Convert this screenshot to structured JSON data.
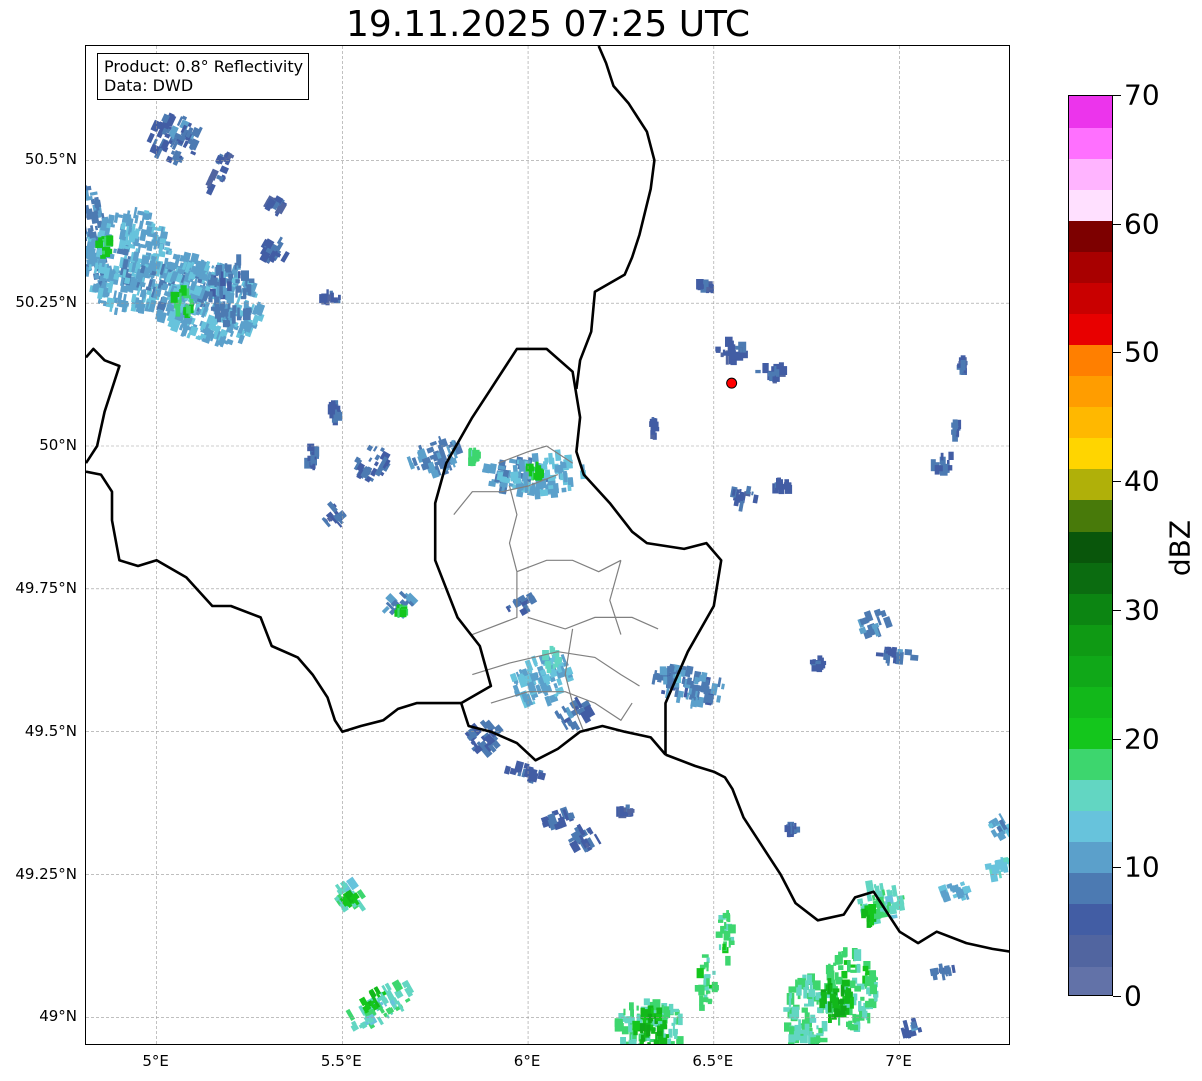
{
  "title": "19.11.2025 07:25 UTC",
  "info_box": {
    "product_line": "Product: 0.8° Reflectivity",
    "data_line": "Data: DWD"
  },
  "map": {
    "lon_range": [
      4.81,
      7.3
    ],
    "lat_range": [
      48.95,
      50.7
    ],
    "lon_ticks": [
      {
        "value": 5.0,
        "label": "5°E"
      },
      {
        "value": 5.5,
        "label": "5.5°E"
      },
      {
        "value": 6.0,
        "label": "6°E"
      },
      {
        "value": 6.5,
        "label": "6.5°E"
      },
      {
        "value": 7.0,
        "label": "7°E"
      }
    ],
    "lat_ticks": [
      {
        "value": 50.5,
        "label": "50.5°N"
      },
      {
        "value": 50.25,
        "label": "50.25°N"
      },
      {
        "value": 50.0,
        "label": "50°N"
      },
      {
        "value": 49.75,
        "label": "49.75°N"
      },
      {
        "value": 49.5,
        "label": "49.5°N"
      },
      {
        "value": 49.25,
        "label": "49.25°N"
      },
      {
        "value": 49.0,
        "label": "49°N"
      }
    ],
    "grid": true,
    "radar_site": {
      "lon": 6.548,
      "lat": 50.11,
      "color": "#ff0000"
    },
    "borders": [
      [
        [
          4.81,
          50.155
        ],
        [
          4.83,
          50.17
        ],
        [
          4.86,
          50.15
        ],
        [
          4.9,
          50.14
        ],
        [
          4.88,
          50.1
        ],
        [
          4.86,
          50.06
        ],
        [
          4.84,
          50.0
        ],
        [
          4.82,
          49.98
        ],
        [
          4.81,
          49.97
        ]
      ],
      [
        [
          4.81,
          49.955
        ],
        [
          4.85,
          49.95
        ],
        [
          4.88,
          49.92
        ],
        [
          4.88,
          49.87
        ],
        [
          4.9,
          49.8
        ],
        [
          4.95,
          49.79
        ],
        [
          5.0,
          49.8
        ],
        [
          5.08,
          49.77
        ],
        [
          5.15,
          49.72
        ],
        [
          5.2,
          49.72
        ],
        [
          5.28,
          49.7
        ],
        [
          5.31,
          49.65
        ],
        [
          5.38,
          49.63
        ],
        [
          5.42,
          49.6
        ],
        [
          5.46,
          49.56
        ],
        [
          5.48,
          49.52
        ],
        [
          5.5,
          49.5
        ],
        [
          5.55,
          49.51
        ],
        [
          5.61,
          49.52
        ],
        [
          5.65,
          49.54
        ],
        [
          5.7,
          49.55
        ],
        [
          5.76,
          49.55
        ],
        [
          5.82,
          49.55
        ]
      ],
      [
        [
          5.82,
          49.55
        ],
        [
          5.84,
          49.51
        ],
        [
          5.9,
          49.5
        ],
        [
          5.97,
          49.48
        ],
        [
          6.02,
          49.45
        ],
        [
          6.08,
          49.47
        ],
        [
          6.14,
          49.5
        ],
        [
          6.2,
          49.51
        ],
        [
          6.26,
          49.5
        ],
        [
          6.33,
          49.49
        ],
        [
          6.37,
          49.46
        ]
      ],
      [
        [
          6.37,
          49.46
        ],
        [
          6.45,
          49.44
        ],
        [
          6.5,
          49.43
        ],
        [
          6.53,
          49.42
        ],
        [
          6.55,
          49.4
        ],
        [
          6.58,
          49.35
        ],
        [
          6.62,
          49.31
        ],
        [
          6.65,
          49.28
        ],
        [
          6.68,
          49.25
        ],
        [
          6.72,
          49.2
        ],
        [
          6.78,
          49.17
        ],
        [
          6.85,
          49.18
        ],
        [
          6.88,
          49.21
        ],
        [
          6.93,
          49.22
        ],
        [
          6.97,
          49.18
        ],
        [
          7.0,
          49.15
        ],
        [
          7.05,
          49.13
        ],
        [
          7.1,
          49.15
        ],
        [
          7.18,
          49.13
        ],
        [
          7.25,
          49.12
        ],
        [
          7.3,
          49.115
        ]
      ],
      [
        [
          6.37,
          49.46
        ],
        [
          6.37,
          49.55
        ],
        [
          6.43,
          49.64
        ],
        [
          6.5,
          49.72
        ],
        [
          6.52,
          49.8
        ],
        [
          6.48,
          49.83
        ],
        [
          6.42,
          49.82
        ],
        [
          6.32,
          49.83
        ],
        [
          6.28,
          49.85
        ],
        [
          6.22,
          49.9
        ],
        [
          6.15,
          49.95
        ],
        [
          6.13,
          49.99
        ],
        [
          6.14,
          50.05
        ],
        [
          6.12,
          50.13
        ],
        [
          6.05,
          50.17
        ],
        [
          5.97,
          50.17
        ],
        [
          5.9,
          50.1
        ],
        [
          5.85,
          50.05
        ],
        [
          5.78,
          49.97
        ],
        [
          5.75,
          49.9
        ],
        [
          5.75,
          49.8
        ],
        [
          5.81,
          49.7
        ],
        [
          5.87,
          49.65
        ],
        [
          5.9,
          49.58
        ],
        [
          5.82,
          49.55
        ]
      ],
      [
        [
          6.13,
          50.1
        ],
        [
          6.14,
          50.15
        ],
        [
          6.17,
          50.2
        ],
        [
          6.18,
          50.27
        ],
        [
          6.26,
          50.3
        ],
        [
          6.28,
          50.33
        ],
        [
          6.3,
          50.37
        ],
        [
          6.33,
          50.45
        ],
        [
          6.34,
          50.5
        ],
        [
          6.32,
          50.55
        ],
        [
          6.27,
          50.6
        ],
        [
          6.23,
          50.63
        ],
        [
          6.21,
          50.67
        ],
        [
          6.19,
          50.7
        ]
      ]
    ],
    "admin_lines": [
      [
        [
          6.08,
          49.95
        ],
        [
          6.0,
          49.93
        ],
        [
          5.93,
          49.92
        ],
        [
          5.85,
          49.92
        ],
        [
          5.8,
          49.88
        ]
      ],
      [
        [
          5.95,
          49.93
        ],
        [
          5.97,
          49.88
        ],
        [
          5.95,
          49.83
        ],
        [
          5.97,
          49.78
        ]
      ],
      [
        [
          5.97,
          49.78
        ],
        [
          6.05,
          49.8
        ],
        [
          6.12,
          49.8
        ],
        [
          6.19,
          49.78
        ],
        [
          6.25,
          49.8
        ]
      ],
      [
        [
          6.25,
          49.8
        ],
        [
          6.22,
          49.73
        ],
        [
          6.25,
          49.67
        ]
      ],
      [
        [
          5.97,
          49.78
        ],
        [
          5.97,
          49.7
        ],
        [
          5.85,
          49.67
        ]
      ],
      [
        [
          6.0,
          49.7
        ],
        [
          6.1,
          49.68
        ],
        [
          6.18,
          49.7
        ],
        [
          6.28,
          49.7
        ],
        [
          6.35,
          49.68
        ]
      ],
      [
        [
          5.85,
          49.6
        ],
        [
          5.95,
          49.62
        ],
        [
          6.08,
          49.64
        ],
        [
          6.18,
          49.63
        ],
        [
          6.25,
          49.6
        ],
        [
          6.3,
          49.58
        ]
      ],
      [
        [
          5.9,
          49.55
        ],
        [
          6.0,
          49.57
        ],
        [
          6.1,
          49.57
        ],
        [
          6.18,
          49.55
        ],
        [
          6.25,
          49.52
        ],
        [
          6.28,
          49.55
        ]
      ],
      [
        [
          6.12,
          49.68
        ],
        [
          6.1,
          49.6
        ],
        [
          6.12,
          49.55
        ],
        [
          6.15,
          49.5
        ]
      ],
      [
        [
          5.92,
          49.97
        ],
        [
          6.0,
          49.99
        ],
        [
          6.05,
          50.0
        ],
        [
          6.12,
          49.97
        ]
      ]
    ]
  },
  "colorbar": {
    "label": "dBZ",
    "min": 0,
    "max": 70,
    "ticks": [
      {
        "value": 0,
        "label": "0"
      },
      {
        "value": 10,
        "label": "10"
      },
      {
        "value": 20,
        "label": "20"
      },
      {
        "value": 30,
        "label": "30"
      },
      {
        "value": 40,
        "label": "40"
      },
      {
        "value": 50,
        "label": "50"
      },
      {
        "value": 60,
        "label": "60"
      },
      {
        "value": 70,
        "label": "70"
      }
    ],
    "colors": [
      "#6272a8",
      "#5165a0",
      "#425da4",
      "#4c7ab2",
      "#5ba0cb",
      "#67c3dc",
      "#62d6c2",
      "#3dd66e",
      "#14c61c",
      "#12b81a",
      "#10a818",
      "#0f9a14",
      "#0c8512",
      "#0b6c10",
      "#09560b",
      "#487a0a",
      "#b0b009",
      "#ffd500",
      "#ffb800",
      "#ff9d00",
      "#ff7f00",
      "#e80000",
      "#c90000",
      "#a80000",
      "#7d0000",
      "#ffe0ff",
      "#ffb4ff",
      "#ff70ff",
      "#ec34ec"
    ]
  },
  "echo_clusters": [
    {
      "lon": 4.83,
      "lat": 50.37,
      "rx": 0.04,
      "ry": 0.1,
      "angle": -10,
      "level": 10
    },
    {
      "lon": 4.93,
      "lat": 50.32,
      "rx": 0.12,
      "ry": 0.09,
      "angle": 10,
      "level": 12
    },
    {
      "lon": 5.05,
      "lat": 50.28,
      "rx": 0.1,
      "ry": 0.06,
      "angle": 15,
      "level": 11
    },
    {
      "lon": 5.15,
      "lat": 50.25,
      "rx": 0.14,
      "ry": 0.07,
      "angle": 20,
      "level": 12
    },
    {
      "lon": 5.07,
      "lat": 50.25,
      "rx": 0.03,
      "ry": 0.03,
      "angle": 0,
      "level": 20
    },
    {
      "lon": 4.86,
      "lat": 50.35,
      "rx": 0.02,
      "ry": 0.02,
      "angle": 0,
      "level": 20
    },
    {
      "lon": 5.05,
      "lat": 50.54,
      "rx": 0.07,
      "ry": 0.04,
      "angle": 25,
      "level": 8
    },
    {
      "lon": 5.17,
      "lat": 50.48,
      "rx": 0.02,
      "ry": 0.04,
      "angle": 25,
      "level": 6
    },
    {
      "lon": 5.32,
      "lat": 50.42,
      "rx": 0.025,
      "ry": 0.012,
      "angle": 30,
      "level": 6
    },
    {
      "lon": 5.32,
      "lat": 50.34,
      "rx": 0.035,
      "ry": 0.025,
      "angle": 30,
      "level": 7
    },
    {
      "lon": 5.2,
      "lat": 50.27,
      "rx": 0.06,
      "ry": 0.06,
      "angle": 0,
      "level": 9
    },
    {
      "lon": 5.47,
      "lat": 50.26,
      "rx": 0.025,
      "ry": 0.01,
      "angle": 0,
      "level": 6
    },
    {
      "lon": 5.42,
      "lat": 49.98,
      "rx": 0.015,
      "ry": 0.02,
      "angle": 0,
      "level": 7
    },
    {
      "lon": 5.58,
      "lat": 49.97,
      "rx": 0.04,
      "ry": 0.03,
      "angle": 30,
      "level": 8
    },
    {
      "lon": 5.75,
      "lat": 49.98,
      "rx": 0.07,
      "ry": 0.03,
      "angle": -20,
      "level": 10
    },
    {
      "lon": 5.96,
      "lat": 49.95,
      "rx": 0.09,
      "ry": 0.03,
      "angle": 10,
      "level": 11
    },
    {
      "lon": 6.05,
      "lat": 49.95,
      "rx": 0.1,
      "ry": 0.035,
      "angle": -5,
      "level": 12
    },
    {
      "lon": 6.02,
      "lat": 49.96,
      "rx": 0.02,
      "ry": 0.015,
      "angle": 0,
      "level": 20
    },
    {
      "lon": 5.85,
      "lat": 49.98,
      "rx": 0.015,
      "ry": 0.012,
      "angle": 0,
      "level": 18
    },
    {
      "lon": 5.48,
      "lat": 49.88,
      "rx": 0.035,
      "ry": 0.02,
      "angle": -40,
      "level": 7
    },
    {
      "lon": 5.48,
      "lat": 50.06,
      "rx": 0.012,
      "ry": 0.015,
      "angle": 0,
      "level": 7
    },
    {
      "lon": 5.65,
      "lat": 49.72,
      "rx": 0.045,
      "ry": 0.02,
      "angle": -45,
      "level": 10
    },
    {
      "lon": 5.66,
      "lat": 49.71,
      "rx": 0.012,
      "ry": 0.008,
      "angle": 0,
      "level": 20
    },
    {
      "lon": 5.98,
      "lat": 49.72,
      "rx": 0.04,
      "ry": 0.015,
      "angle": -30,
      "level": 8
    },
    {
      "lon": 6.04,
      "lat": 49.59,
      "rx": 0.09,
      "ry": 0.04,
      "angle": -20,
      "level": 12
    },
    {
      "lon": 6.06,
      "lat": 49.62,
      "rx": 0.025,
      "ry": 0.025,
      "angle": 0,
      "level": 16
    },
    {
      "lon": 6.12,
      "lat": 49.53,
      "rx": 0.05,
      "ry": 0.02,
      "angle": -30,
      "level": 8
    },
    {
      "lon": 5.88,
      "lat": 49.49,
      "rx": 0.05,
      "ry": 0.025,
      "angle": -40,
      "level": 8
    },
    {
      "lon": 5.99,
      "lat": 49.43,
      "rx": 0.05,
      "ry": 0.015,
      "angle": 15,
      "level": 7
    },
    {
      "lon": 6.08,
      "lat": 49.35,
      "rx": 0.04,
      "ry": 0.015,
      "angle": -20,
      "level": 7
    },
    {
      "lon": 6.15,
      "lat": 49.31,
      "rx": 0.04,
      "ry": 0.02,
      "angle": -30,
      "level": 7
    },
    {
      "lon": 6.26,
      "lat": 49.36,
      "rx": 0.02,
      "ry": 0.006,
      "angle": 0,
      "level": 6
    },
    {
      "lon": 6.43,
      "lat": 49.58,
      "rx": 0.1,
      "ry": 0.03,
      "angle": 10,
      "level": 9
    },
    {
      "lon": 6.39,
      "lat": 49.6,
      "rx": 0.03,
      "ry": 0.02,
      "angle": 0,
      "level": 11
    },
    {
      "lon": 6.58,
      "lat": 49.91,
      "rx": 0.035,
      "ry": 0.015,
      "angle": 10,
      "level": 7
    },
    {
      "lon": 6.68,
      "lat": 49.93,
      "rx": 0.03,
      "ry": 0.01,
      "angle": 0,
      "level": 6
    },
    {
      "lon": 6.55,
      "lat": 50.17,
      "rx": 0.04,
      "ry": 0.025,
      "angle": 0,
      "level": 6
    },
    {
      "lon": 6.65,
      "lat": 50.13,
      "rx": 0.04,
      "ry": 0.012,
      "angle": 0,
      "level": 6
    },
    {
      "lon": 6.48,
      "lat": 50.28,
      "rx": 0.02,
      "ry": 0.008,
      "angle": 0,
      "level": 6
    },
    {
      "lon": 6.34,
      "lat": 50.03,
      "rx": 0.01,
      "ry": 0.015,
      "angle": 0,
      "level": 6
    },
    {
      "lon": 7.12,
      "lat": 49.97,
      "rx": 0.03,
      "ry": 0.02,
      "angle": 0,
      "level": 8
    },
    {
      "lon": 7.15,
      "lat": 50.03,
      "rx": 0.008,
      "ry": 0.015,
      "angle": 0,
      "level": 7
    },
    {
      "lon": 7.17,
      "lat": 50.14,
      "rx": 0.012,
      "ry": 0.012,
      "angle": 0,
      "level": 6
    },
    {
      "lon": 6.93,
      "lat": 49.69,
      "rx": 0.04,
      "ry": 0.02,
      "angle": -20,
      "level": 9
    },
    {
      "lon": 7.0,
      "lat": 49.63,
      "rx": 0.07,
      "ry": 0.012,
      "angle": 5,
      "level": 8
    },
    {
      "lon": 6.78,
      "lat": 49.62,
      "rx": 0.02,
      "ry": 0.006,
      "angle": 0,
      "level": 7
    },
    {
      "lon": 7.27,
      "lat": 49.33,
      "rx": 0.03,
      "ry": 0.02,
      "angle": -30,
      "level": 11
    },
    {
      "lon": 6.71,
      "lat": 49.33,
      "rx": 0.015,
      "ry": 0.006,
      "angle": 0,
      "level": 7
    },
    {
      "lon": 5.52,
      "lat": 49.21,
      "rx": 0.04,
      "ry": 0.025,
      "angle": -35,
      "level": 16
    },
    {
      "lon": 5.52,
      "lat": 49.21,
      "rx": 0.015,
      "ry": 0.012,
      "angle": -35,
      "level": 22
    },
    {
      "lon": 5.6,
      "lat": 49.02,
      "rx": 0.1,
      "ry": 0.025,
      "angle": -30,
      "level": 16
    },
    {
      "lon": 5.58,
      "lat": 49.03,
      "rx": 0.04,
      "ry": 0.015,
      "angle": -30,
      "level": 22
    },
    {
      "lon": 6.33,
      "lat": 48.98,
      "rx": 0.09,
      "ry": 0.05,
      "angle": 0,
      "level": 17
    },
    {
      "lon": 6.33,
      "lat": 48.98,
      "rx": 0.05,
      "ry": 0.035,
      "angle": 0,
      "level": 23
    },
    {
      "lon": 6.48,
      "lat": 49.06,
      "rx": 0.025,
      "ry": 0.05,
      "angle": 0,
      "level": 18
    },
    {
      "lon": 6.53,
      "lat": 49.14,
      "rx": 0.02,
      "ry": 0.045,
      "angle": 0,
      "level": 18
    },
    {
      "lon": 6.75,
      "lat": 49.0,
      "rx": 0.06,
      "ry": 0.07,
      "angle": 0,
      "level": 17
    },
    {
      "lon": 6.87,
      "lat": 49.05,
      "rx": 0.07,
      "ry": 0.07,
      "angle": 0,
      "level": 18
    },
    {
      "lon": 6.83,
      "lat": 49.03,
      "rx": 0.04,
      "ry": 0.04,
      "angle": 0,
      "level": 24
    },
    {
      "lon": 6.95,
      "lat": 49.2,
      "rx": 0.06,
      "ry": 0.035,
      "angle": -10,
      "level": 16
    },
    {
      "lon": 6.92,
      "lat": 49.18,
      "rx": 0.02,
      "ry": 0.015,
      "angle": 0,
      "level": 22
    },
    {
      "lon": 7.15,
      "lat": 49.22,
      "rx": 0.04,
      "ry": 0.015,
      "angle": -20,
      "level": 12
    },
    {
      "lon": 7.27,
      "lat": 49.26,
      "rx": 0.04,
      "ry": 0.015,
      "angle": -10,
      "level": 14
    },
    {
      "lon": 7.03,
      "lat": 48.98,
      "rx": 0.04,
      "ry": 0.012,
      "angle": -15,
      "level": 8
    },
    {
      "lon": 7.12,
      "lat": 49.08,
      "rx": 0.03,
      "ry": 0.008,
      "angle": -10,
      "level": 7
    }
  ]
}
